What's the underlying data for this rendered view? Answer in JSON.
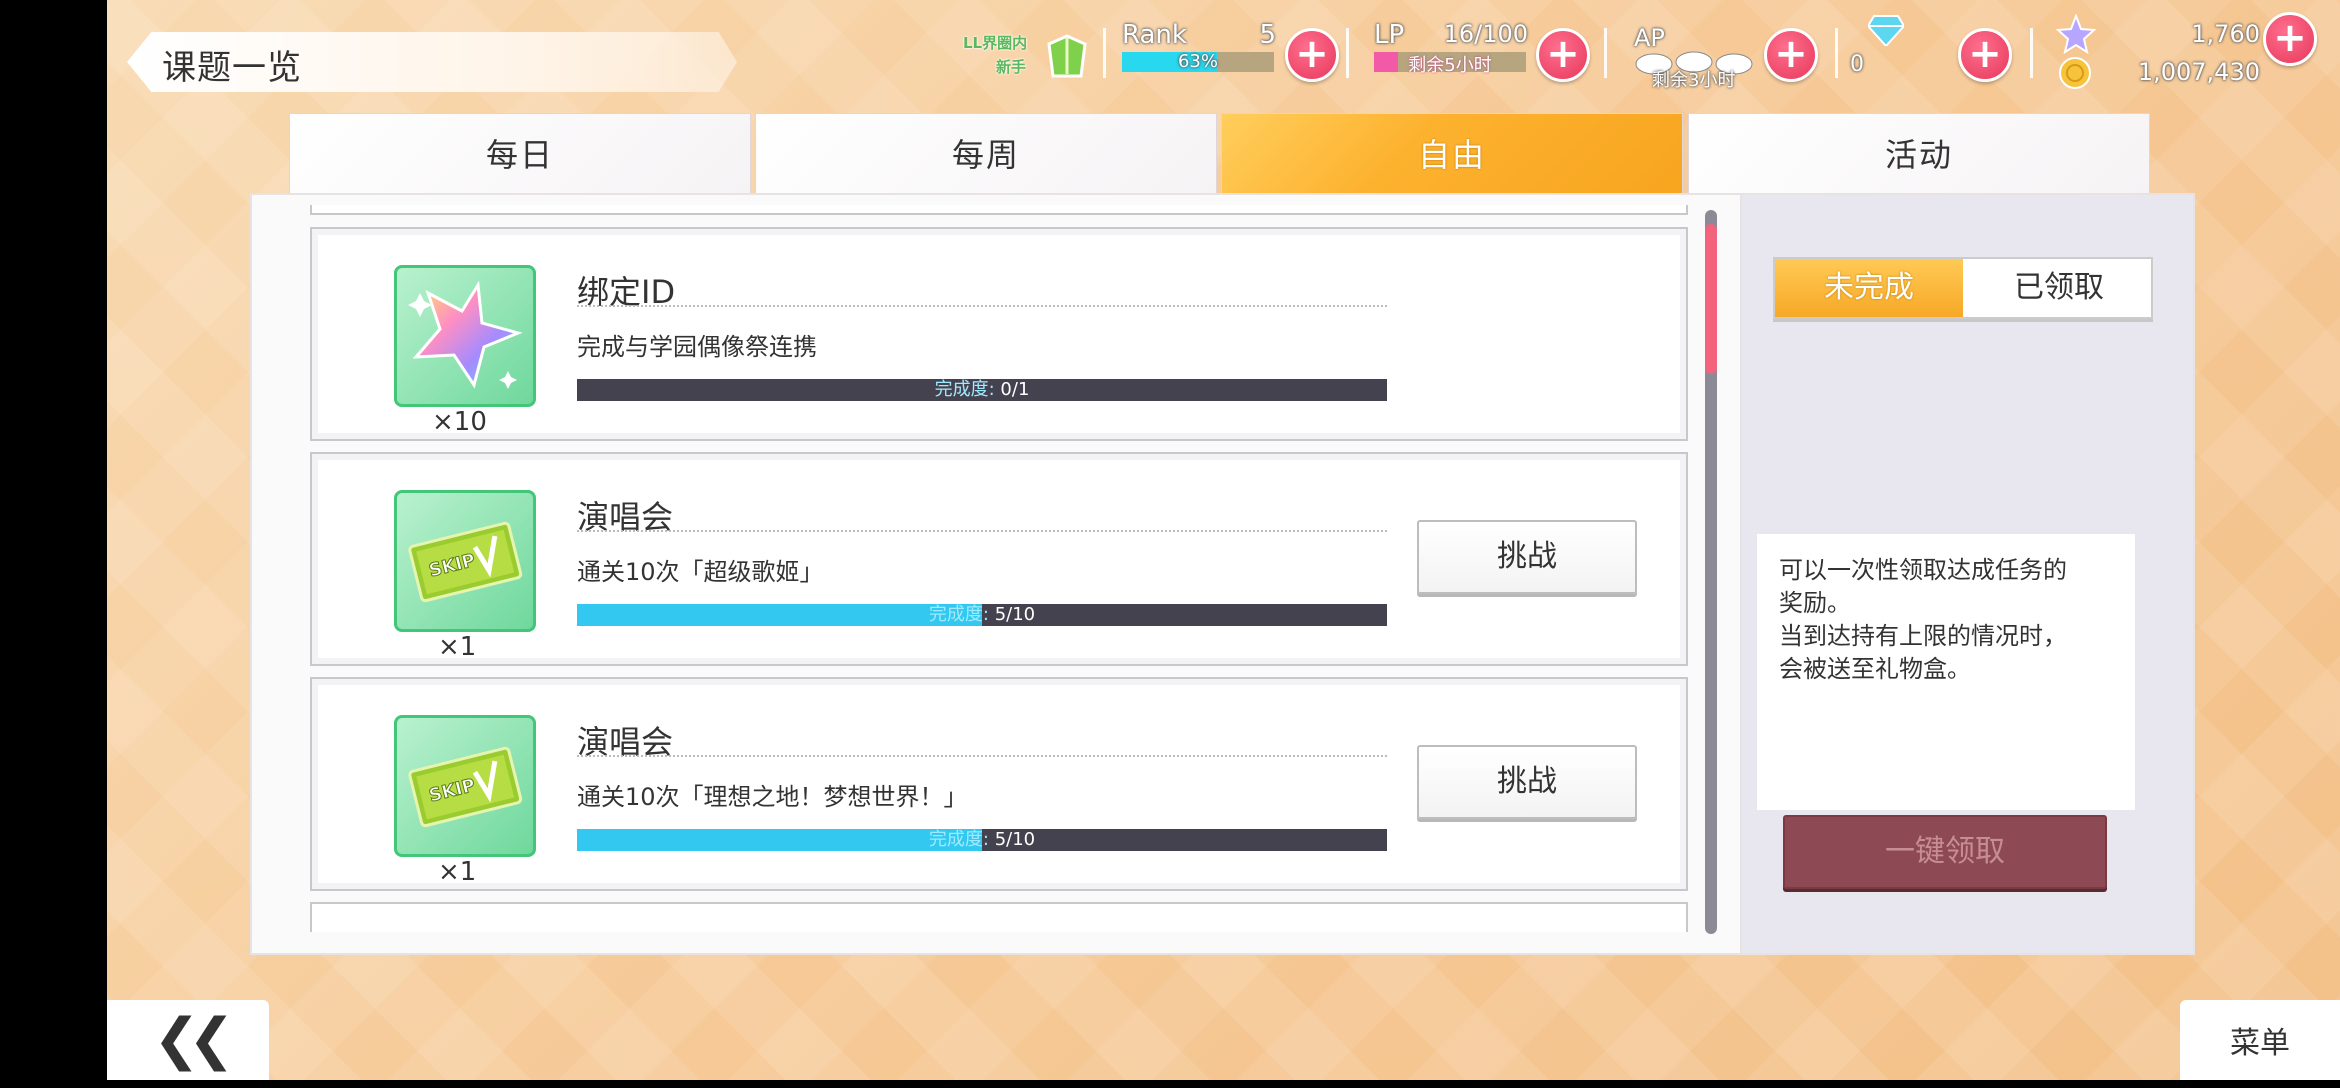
{
  "header": {
    "title": "课题一览",
    "badge_line1": "LL界圈内",
    "badge_line2": "新手",
    "rank_label": "Rank",
    "rank_value": "5",
    "rank_progress": "63%",
    "lp_label": "LP",
    "lp_value": "16/100",
    "lp_timer": "剩余5小时",
    "ap_label": "AP",
    "ap_timer": "剩余3小时",
    "gem_count": "0",
    "star_currency": "1,760",
    "coin_currency": "1,007,430"
  },
  "tabs": [
    {
      "label": "每日",
      "active": false
    },
    {
      "label": "每周",
      "active": false
    },
    {
      "label": "自由",
      "active": true
    },
    {
      "label": "活动",
      "active": false
    }
  ],
  "quests": [
    {
      "title": "绑定ID",
      "desc": "完成与学园偶像祭连携",
      "progress_label": "完成度:",
      "progress_value": "0/1",
      "progress_fraction": 0,
      "reward_icon": "star-crystal-icon",
      "reward_mult": "×10",
      "button": ""
    },
    {
      "title": "演唱会",
      "desc": "通关10次「超级歌姬」",
      "progress_label": "完成度:",
      "progress_value": "5/10",
      "progress_fraction": 0.5,
      "reward_icon": "skip-ticket-icon",
      "reward_mult": "×1",
      "button": "挑战"
    },
    {
      "title": "演唱会",
      "desc": "通关10次「理想之地！梦想世界！」",
      "progress_label": "完成度:",
      "progress_value": "5/10",
      "progress_fraction": 0.5,
      "reward_icon": "skip-ticket-icon",
      "reward_mult": "×1",
      "button": "挑战"
    }
  ],
  "filter": {
    "incomplete": "未完成",
    "claimed": "已领取"
  },
  "note": {
    "line1": "可以一次性领取达成任务的",
    "line2": "奖励。",
    "line3": "当到达持有上限的情况时，",
    "line4": "会被送至礼物盒。"
  },
  "claim_all": "一键领取",
  "footer": {
    "back": "❮❮",
    "menu": "菜单"
  },
  "colors": {
    "active_tab": "#fdb22f",
    "progress_fill": "#33c8f0",
    "plus_button": "#e6385b",
    "scroll_thumb": "#f2647e"
  }
}
